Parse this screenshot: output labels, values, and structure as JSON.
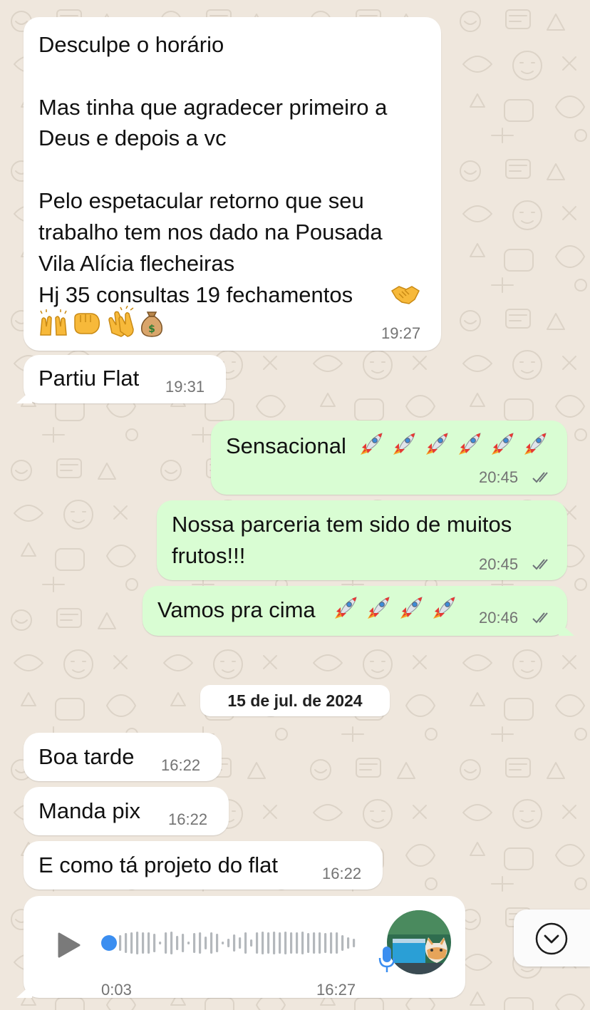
{
  "colors": {
    "incoming_bubble": "#ffffff",
    "outgoing_bubble": "#d9fdd3",
    "wallpaper": "#efe7dd",
    "read_ticks": "#6d7278",
    "audio_progress_dot": "#3b8ef0"
  },
  "messages": [
    {
      "direction": "incoming",
      "lines": [
        "Desculpe o horário",
        "Mas tinha que agradecer primeiro a",
        "Deus e depois a vc",
        "Pelo espetacular retorno que seu",
        "trabalho tem nos dado na Pousada",
        "Vila Alícia flecheiras",
        "Hj 35 consultas 19 fechamentos"
      ],
      "emojis": [
        "handshake-emoji",
        "raising-hands-emoji",
        "oncoming-fist-emoji",
        "clapping-hands-emoji",
        "money-bag-emoji"
      ],
      "time": "19:27"
    },
    {
      "direction": "incoming",
      "text": "Partiu Flat",
      "time": "19:31"
    },
    {
      "direction": "outgoing",
      "text": "Sensacional",
      "emojis": [
        "rocket-emoji",
        "rocket-emoji",
        "rocket-emoji",
        "rocket-emoji",
        "rocket-emoji",
        "rocket-emoji"
      ],
      "time": "20:45",
      "status": "read"
    },
    {
      "direction": "outgoing",
      "lines": [
        "Nossa parceria tem sido de muitos",
        "frutos!!!"
      ],
      "time": "20:45",
      "status": "read"
    },
    {
      "direction": "outgoing",
      "text": "Vamos pra cima",
      "emojis": [
        "rocket-emoji",
        "rocket-emoji",
        "rocket-emoji",
        "rocket-emoji"
      ],
      "time": "20:46",
      "status": "read"
    }
  ],
  "date_divider": "15 de jul. de 2024",
  "messages_after": [
    {
      "direction": "incoming",
      "text": "Boa tarde",
      "time": "16:22"
    },
    {
      "direction": "incoming",
      "text": "Manda pix",
      "time": "16:22"
    },
    {
      "direction": "incoming",
      "text": "E como tá projeto do flat",
      "time": "16:22"
    }
  ],
  "voice_message": {
    "direction": "incoming",
    "duration": "0:03",
    "time": "16:27",
    "progress": 0,
    "icons": [
      "play-icon",
      "microphone-icon"
    ]
  },
  "scroll_button": {
    "icon": "chevron-down-icon"
  }
}
